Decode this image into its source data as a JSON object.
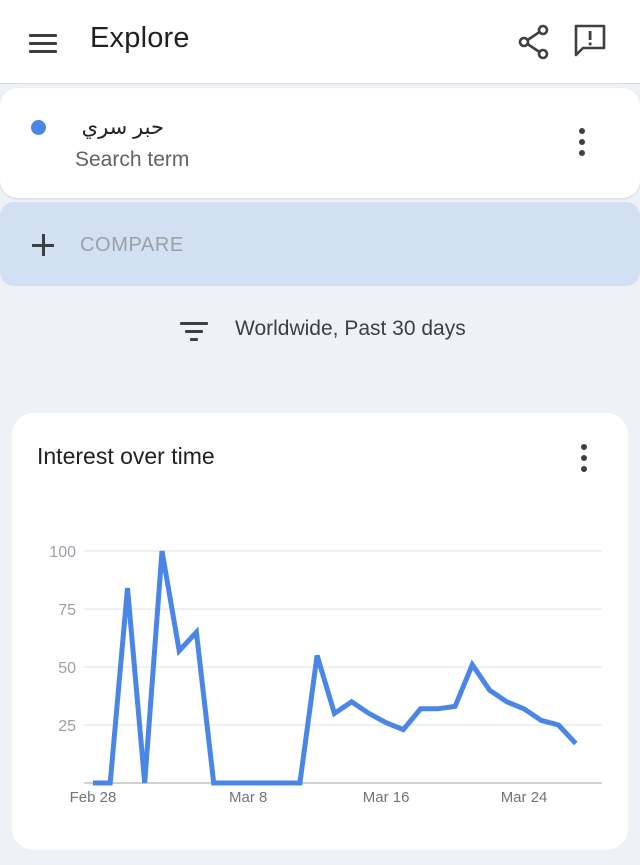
{
  "app_bar": {
    "title": "Explore",
    "menu_icon": "hamburger-menu-icon",
    "share_icon": "share-icon",
    "feedback_icon": "feedback-icon"
  },
  "search_term": {
    "name": "حبر سري",
    "subtitle": "Search term",
    "color": "#4a86e8",
    "menu_icon": "more-vert-icon"
  },
  "compare": {
    "label": "COMPARE",
    "icon": "plus-icon"
  },
  "filter": {
    "label": "Worldwide, Past 30 days",
    "icon": "filter-icon"
  },
  "interest_card": {
    "title": "Interest over time",
    "menu_icon": "more-vert-icon"
  },
  "chart_data": {
    "type": "line",
    "title": "Interest over time",
    "xlabel": "",
    "ylabel": "",
    "ylim": [
      0,
      100
    ],
    "y_ticks": [
      "25",
      "50",
      "75",
      "100"
    ],
    "x_ticks": [
      "Feb 28",
      "Mar 8",
      "Mar 16",
      "Mar 24"
    ],
    "grid": true,
    "series": [
      {
        "color": "#4a86e8",
        "x": [
          "Feb 28",
          "Feb 29",
          "Mar 1",
          "Mar 2",
          "Mar 3",
          "Mar 4",
          "Mar 5",
          "Mar 6",
          "Mar 7",
          "Mar 8",
          "Mar 9",
          "Mar 10",
          "Mar 11",
          "Mar 12",
          "Mar 13",
          "Mar 14",
          "Mar 15",
          "Mar 16",
          "Mar 17",
          "Mar 18",
          "Mar 19",
          "Mar 20",
          "Mar 21",
          "Mar 22",
          "Mar 23",
          "Mar 24",
          "Mar 25",
          "Mar 26",
          "Mar 27",
          "Mar 28"
        ],
        "values": [
          0,
          0,
          84,
          0,
          100,
          57,
          65,
          0,
          0,
          0,
          0,
          0,
          0,
          55,
          30,
          35,
          30,
          26,
          23,
          32,
          32,
          33,
          51,
          40,
          35,
          32,
          27,
          25,
          17,
          null
        ]
      }
    ]
  }
}
